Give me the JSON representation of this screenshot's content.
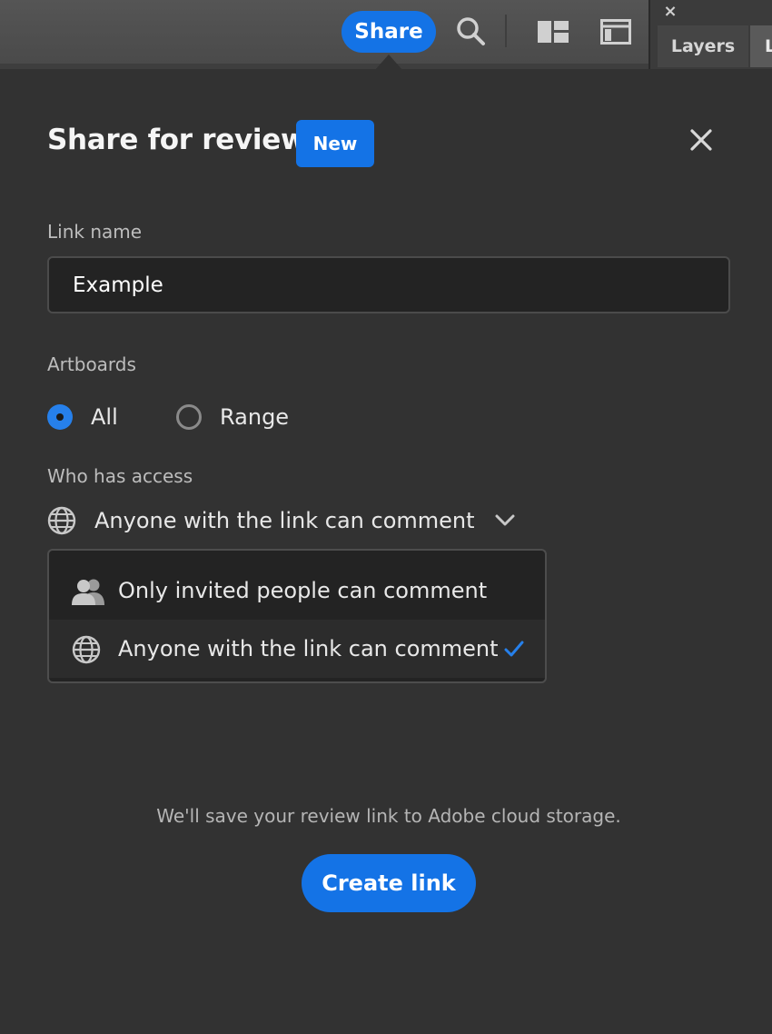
{
  "toolbar": {
    "share_label": "Share",
    "icons": [
      "search-icon",
      "layout-grid-icon",
      "panel-toggle-icon"
    ]
  },
  "side_panel": {
    "close_glyph": "×",
    "tabs": [
      {
        "label": "Layers"
      },
      {
        "label": "L"
      }
    ]
  },
  "dialog": {
    "title": "Share for review",
    "badge": "New",
    "link_name": {
      "label": "Link name",
      "value": "Example"
    },
    "artboards": {
      "label": "Artboards",
      "options": [
        {
          "label": "All",
          "selected": true
        },
        {
          "label": "Range",
          "selected": false
        }
      ]
    },
    "access": {
      "label": "Who has access",
      "selected_text": "Anyone with the link can comment",
      "menu_items": [
        {
          "label": "Only invited people can comment",
          "icon": "people-icon",
          "checked": false
        },
        {
          "label": "Anyone with the link can comment",
          "icon": "globe-icon",
          "checked": true
        }
      ]
    },
    "footnote": "We'll save your review link to Adobe cloud storage.",
    "create_button": "Create link"
  },
  "colors": {
    "accent": "#1473e6",
    "check": "#2680eb",
    "background": "#323232"
  }
}
